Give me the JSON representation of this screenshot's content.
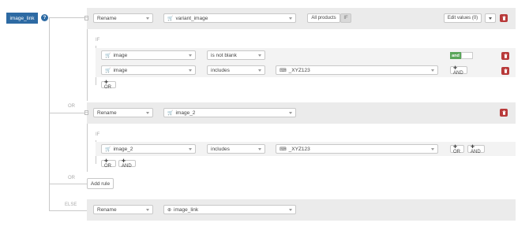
{
  "field": {
    "name": "image_link",
    "help_glyph": "?"
  },
  "labels": {
    "or": "OR",
    "if": "IF",
    "else": "ELSE"
  },
  "top_rule": {
    "action": "Rename",
    "target": "variant_image",
    "all_products": "All products",
    "if_badge": "IF",
    "edit_values": "Edit values (0)"
  },
  "cond1": {
    "row1": {
      "field": "image",
      "op": "is not blank",
      "connector": "and"
    },
    "row2": {
      "field": "image",
      "op": "includes",
      "value": "_XYZ123",
      "and_btn": "✚ AND"
    },
    "or_btn": "✚ OR"
  },
  "rule2": {
    "action": "Rename",
    "target": "image_2"
  },
  "cond2": {
    "field": "image_2",
    "op": "includes",
    "value": "_XYZ123",
    "or_inline": "✚ OR",
    "and_inline": "✚ AND",
    "or_btn": "✚ OR",
    "and_btn": "✚ AND"
  },
  "add_rule": "Add rule",
  "else_rule": {
    "action": "Rename",
    "target": "image_link"
  },
  "colors": {
    "brand": "#2d6aa3",
    "danger": "#b83a3a",
    "toggle_on": "#5aa65a"
  }
}
